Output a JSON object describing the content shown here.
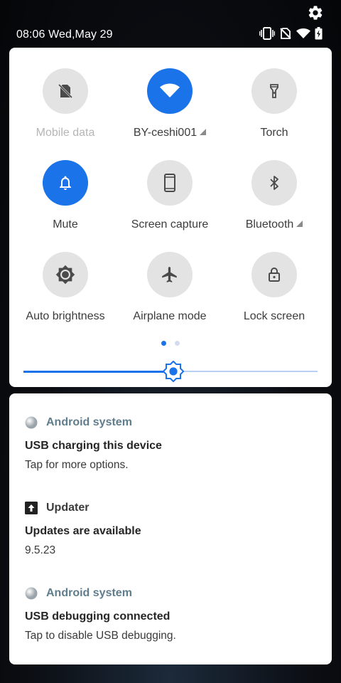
{
  "statusbar": {
    "time": "08:06 Wed,May 29",
    "icons": [
      "vibrate-icon",
      "no-sim-icon",
      "wifi-icon",
      "battery-charging-icon"
    ]
  },
  "settings_icon": "gear-icon",
  "quick_settings": {
    "accent_color": "#1a73e8",
    "tiles": [
      {
        "label": "Mobile data",
        "icon": "no-sim-icon",
        "state": "disabled"
      },
      {
        "label": "BY-ceshi001",
        "icon": "wifi-icon",
        "state": "on",
        "expandable": true
      },
      {
        "label": "Torch",
        "icon": "flashlight-icon",
        "state": "off"
      },
      {
        "label": "Mute",
        "icon": "bell-icon",
        "state": "on"
      },
      {
        "label": "Screen capture",
        "icon": "phone-screenshot-icon",
        "state": "off"
      },
      {
        "label": "Bluetooth",
        "icon": "bluetooth-icon",
        "state": "off",
        "expandable": true
      },
      {
        "label": "Auto brightness",
        "icon": "brightness-icon",
        "state": "off"
      },
      {
        "label": "Airplane mode",
        "icon": "airplane-icon",
        "state": "off"
      },
      {
        "label": "Lock screen",
        "icon": "lock-icon",
        "state": "off"
      }
    ],
    "page_count": 2,
    "current_page": 1,
    "brightness_level": 0.51
  },
  "notifications": [
    {
      "app": "Android system",
      "app_icon": "android-system-icon",
      "title": "USB charging this device",
      "text": "Tap for more options."
    },
    {
      "app": "Updater",
      "app_icon": "upload-arrow-icon",
      "title": "Updates are available",
      "text": "9.5.23"
    },
    {
      "app": "Android system",
      "app_icon": "android-system-icon",
      "title": "USB debugging connected",
      "text": "Tap to disable USB debugging."
    }
  ]
}
